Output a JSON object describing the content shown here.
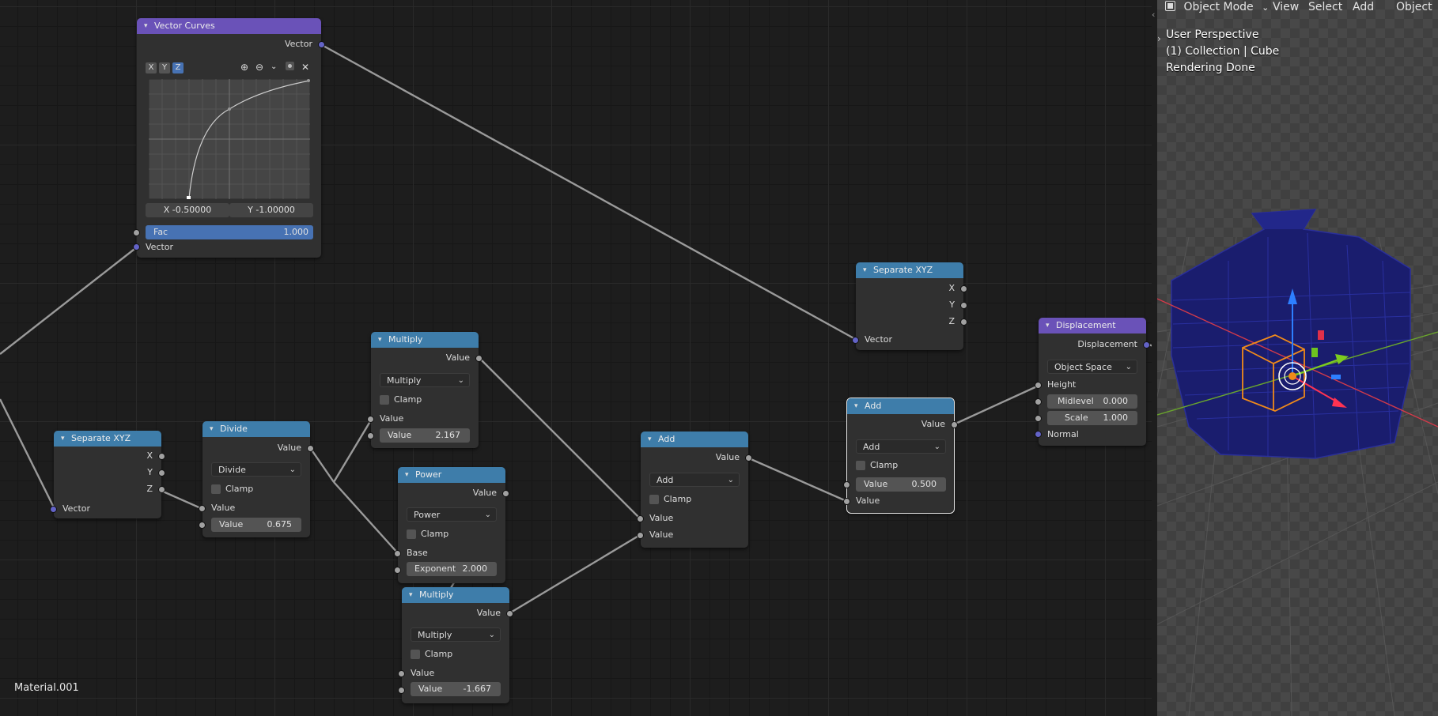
{
  "material_name": "Material.001",
  "viewport": {
    "mode": "Object Mode",
    "menus": [
      "View",
      "Select",
      "Add",
      "Object"
    ],
    "info_lines": [
      "User Perspective",
      "(1) Collection | Cube",
      "Rendering Done"
    ]
  },
  "nodes": {
    "vector_curves": {
      "title": "Vector Curves",
      "output": "Vector",
      "axes": [
        "X",
        "Y",
        "Z"
      ],
      "active_axis": "Z",
      "x_coord": "X -0.50000",
      "y_coord": "Y -1.00000",
      "fac_label": "Fac",
      "fac_value": "1.000",
      "input": "Vector"
    },
    "separate_xyz_1": {
      "title": "Separate XYZ",
      "outputs": [
        "X",
        "Y",
        "Z"
      ],
      "input": "Vector"
    },
    "divide": {
      "title": "Divide",
      "output": "Value",
      "operation": "Divide",
      "clamp_label": "Clamp",
      "input_label": "Value",
      "field_label": "Value",
      "field_value": "0.675"
    },
    "multiply_top": {
      "title": "Multiply",
      "output": "Value",
      "operation": "Multiply",
      "clamp_label": "Clamp",
      "input_label": "Value",
      "field_label": "Value",
      "field_value": "2.167"
    },
    "power": {
      "title": "Power",
      "output": "Value",
      "operation": "Power",
      "clamp_label": "Clamp",
      "base_label": "Base",
      "field_label": "Exponent",
      "field_value": "2.000"
    },
    "multiply_bottom": {
      "title": "Multiply",
      "output": "Value",
      "operation": "Multiply",
      "clamp_label": "Clamp",
      "input_label": "Value",
      "field_label": "Value",
      "field_value": "-1.667"
    },
    "add_mid": {
      "title": "Add",
      "output": "Value",
      "operation": "Add",
      "clamp_label": "Clamp",
      "inputs": [
        "Value",
        "Value"
      ]
    },
    "separate_xyz_2": {
      "title": "Separate XYZ",
      "outputs": [
        "X",
        "Y",
        "Z"
      ],
      "input": "Vector"
    },
    "add_right": {
      "title": "Add",
      "output": "Value",
      "operation": "Add",
      "clamp_label": "Clamp",
      "field_label": "Value",
      "field_value": "0.500",
      "input_label": "Value"
    },
    "displacement": {
      "title": "Displacement",
      "output": "Displacement",
      "space": "Object Space",
      "height_label": "Height",
      "midlevel_label": "Midlevel",
      "midlevel_value": "0.000",
      "scale_label": "Scale",
      "scale_value": "1.000",
      "normal_label": "Normal"
    }
  },
  "colors": {
    "converter_header": "#3e7daa",
    "vector_header": "#6a52b8",
    "node_body": "#303030",
    "link": "#9a9a9a",
    "active_button": "#4772b3"
  }
}
